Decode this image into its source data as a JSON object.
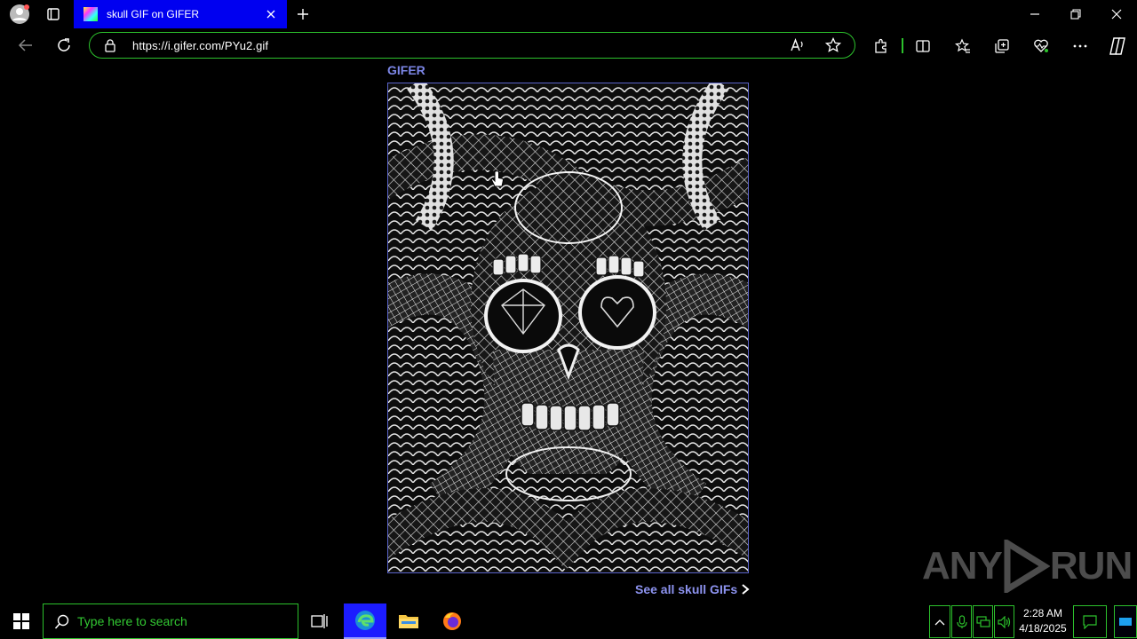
{
  "browser": {
    "tab_title": "skull GIF on GIFER",
    "url": "https://i.gifer.com/PYu2.gif"
  },
  "page": {
    "brand": "GIFER",
    "see_all_link": "See all skull GIFs",
    "gif_alt": "skull lace pattern GIF"
  },
  "taskbar": {
    "search_placeholder": "Type here to search",
    "time": "2:28 AM",
    "date": "4/18/2025"
  },
  "watermark": {
    "left": "ANY",
    "right": "RUN"
  },
  "colors": {
    "tab_active": "#0000f0",
    "accent_green": "#2cc12c",
    "link": "#8d93f0"
  }
}
